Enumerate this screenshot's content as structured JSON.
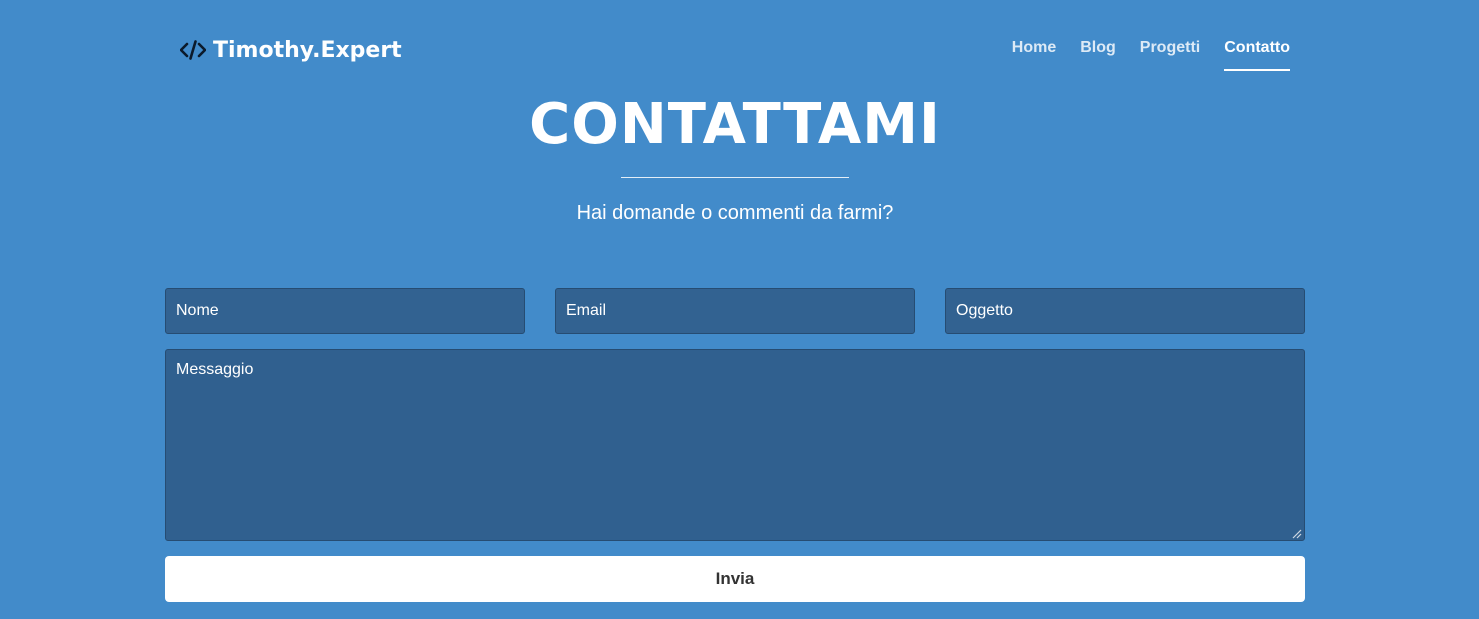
{
  "header": {
    "brand": {
      "icon": "code-icon",
      "name": "Timothy.Expert"
    },
    "nav": [
      {
        "label": "Home",
        "active": false
      },
      {
        "label": "Blog",
        "active": false
      },
      {
        "label": "Progetti",
        "active": false
      },
      {
        "label": "Contatto",
        "active": true
      }
    ]
  },
  "hero": {
    "title": "CONTATTAMI",
    "subtitle": "Hai domande o commenti da farmi?"
  },
  "form": {
    "nome_placeholder": "Nome",
    "email_placeholder": "Email",
    "oggetto_placeholder": "Oggetto",
    "messaggio_placeholder": "Messaggio",
    "submit_label": "Invia"
  },
  "colors": {
    "background": "#428bca",
    "field_background": "#326291",
    "button_background": "#ffffff",
    "text": "#ffffff"
  }
}
